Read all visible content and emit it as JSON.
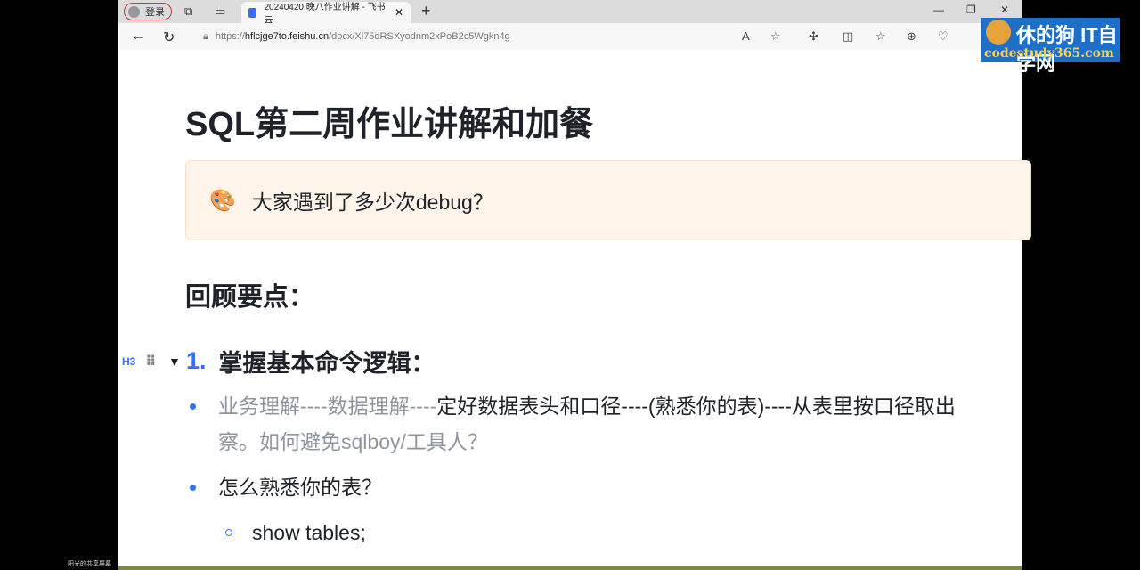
{
  "browser": {
    "login_label": "登录",
    "tab_title": "20240420 晚八作业讲解 - 飞书云",
    "url_prefix": "https://",
    "url_host": "hflcjge7to.feishu.cn",
    "url_path": "/docx/Xl75dRSXyodnm2xPoB2c5Wgkn4g"
  },
  "doc": {
    "title": "SQL第二周作业讲解和加餐",
    "callout": "大家遇到了多少次debug？",
    "heading2": "回顾要点：",
    "h3_tag": "H3",
    "h3_number": "1.",
    "h3_text": "掌握基本命令逻辑：",
    "bullets": [
      {
        "grey": "业务理解----数据理解----",
        "text": "定好数据表头和口径----(熟悉你的表)----从表里按口径取出",
        "line2": "察。如何避免sqlboy/工具人？"
      },
      {
        "text": "怎么熟悉你的表？"
      }
    ],
    "sub_bullets": [
      "show tables;"
    ]
  },
  "watermark": {
    "line1": "休的狗 IT自学网",
    "line2": "codestudy365.com"
  },
  "share_label": "阳光的共享屏幕"
}
